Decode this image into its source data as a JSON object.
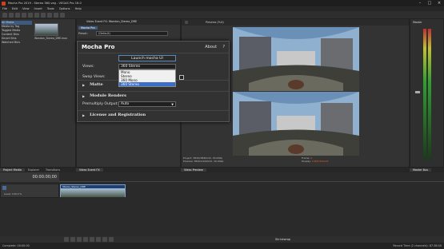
{
  "window": {
    "title": "Mocha Pro 2019 - Stereo 360.veg - VEGAS Pro 16.0",
    "controls": [
      "–",
      "□",
      "×"
    ]
  },
  "menu": [
    "File",
    "Edit",
    "View",
    "Insert",
    "Tools",
    "Options",
    "Help"
  ],
  "explorer": {
    "items": [
      "All Media",
      "Media by Tag",
      "Tagged Media",
      "Content Bins",
      "Smart Bins",
      "Watched Bins"
    ],
    "media_name": "Wandon_Stereo_DRE.mov"
  },
  "video_fx": {
    "title": "Video Event FX: Wandon_Stereo_DRE",
    "chain_label": "Mocha Pro",
    "preset_label": "Preset:",
    "preset_value": "(Default)"
  },
  "preview": {
    "title": "Preview (Full)",
    "project_info": "Project: 3840x3840x32, 30.000p",
    "preview_info": "Preview: 3840x1920x32, 30.000p",
    "frame_label": "Frame:",
    "frame_value": "0",
    "display_label": "Display:",
    "display_value": "1048x344x24"
  },
  "dialog": {
    "title": "Mocha Pro",
    "about": "About",
    "help": "?",
    "launch_button": "Launch mocha UI",
    "views_label": "Views:",
    "views_value": "360 Stereo",
    "swap_views_label": "Swap Views:",
    "dropdown_options": [
      "Mono",
      "Stereo",
      "360 Mono",
      "360 Stereo"
    ],
    "dropdown_selected_index": 3,
    "section_matte": "Matte",
    "section_module_renders": "Module Renders",
    "premultiply_label": "Premultiply Output:",
    "premultiply_value": "Auto",
    "section_license": "License and Registration"
  },
  "panel_tabs": {
    "left": [
      "Project Media",
      "Explorer",
      "Transitions"
    ],
    "middle": [
      "Video Event FX"
    ],
    "preview": [
      "Video Preview"
    ],
    "mixer": [
      "Master Bus"
    ]
  },
  "mixer": {
    "title": "Master"
  },
  "timeline": {
    "timecode": "00:00:00;00",
    "track_level": "Level: 100.0 %",
    "clip_name": "Stereo_Stereo_DRE",
    "rate_label": "Rate: 0.00",
    "status_left": "Complete: 00:00:00",
    "status_right": "Record Time (2 channels): 87:38:00",
    "timecode_bottom": "00:00:00;00",
    "zoom_label": "Shrinkwrap"
  }
}
